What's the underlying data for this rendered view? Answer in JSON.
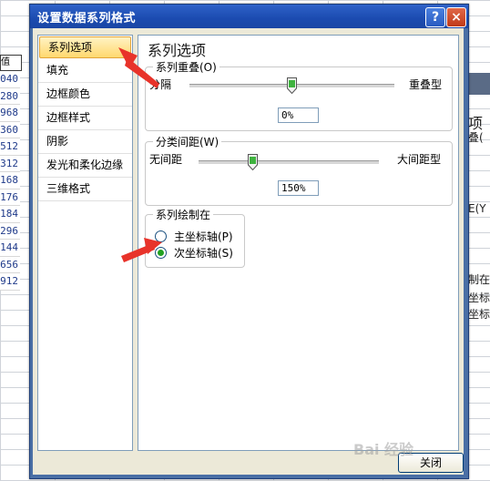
{
  "background": {
    "header_cell": "值",
    "row_values": [
      "040",
      "280",
      "968",
      "360",
      "512",
      "312",
      "168",
      "176",
      "184",
      "296",
      "144",
      "656",
      "912"
    ],
    "right_fragments": [
      "项",
      "叠(",
      "E(Y",
      "制在",
      "坐标轴",
      "坐标轴"
    ]
  },
  "dialog": {
    "title": "设置数据系列格式",
    "help_label": "?",
    "close_label": "×",
    "close_button": "关闭"
  },
  "nav": {
    "items": [
      "系列选项",
      "填充",
      "边框颜色",
      "边框样式",
      "阴影",
      "发光和柔化边缘",
      "三维格式"
    ],
    "selected_index": 0
  },
  "main": {
    "section_title": "系列选项",
    "overlap": {
      "legend": "系列重叠(O)",
      "left_label": "分隔",
      "right_label": "重叠型",
      "value_text": "0%",
      "slider_fraction": 0.5
    },
    "gap": {
      "legend": "分类间距(W)",
      "left_label": "无间距",
      "right_label": "大间距型",
      "value_text": "150%",
      "slider_fraction": 0.3
    },
    "plot_on": {
      "legend": "系列绘制在",
      "options": [
        "主坐标轴(P)",
        "次坐标轴(S)"
      ],
      "selected_index": 1
    }
  },
  "watermark": "Bai 经验",
  "colors": {
    "titlebar": "#2f62c8",
    "selection": "#ffd86e",
    "arrow": "#e8332a",
    "radio_dot": "#21a121"
  }
}
